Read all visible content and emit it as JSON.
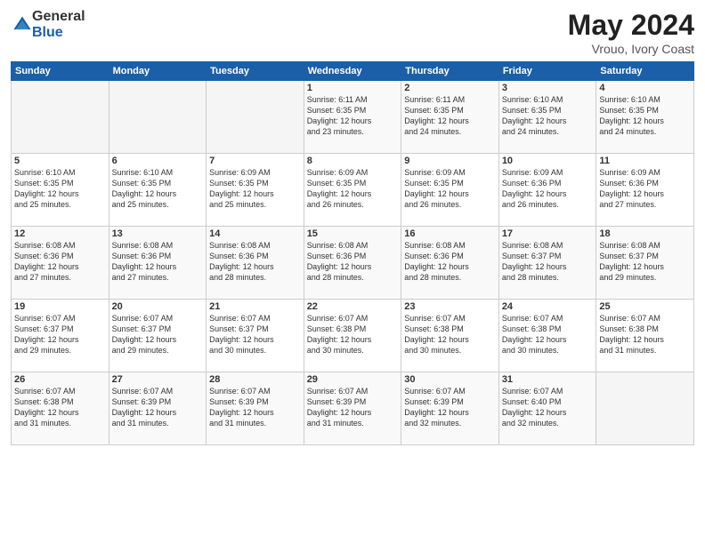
{
  "logo": {
    "general": "General",
    "blue": "Blue"
  },
  "title": {
    "month": "May 2024",
    "location": "Vrouo, Ivory Coast"
  },
  "days_header": [
    "Sunday",
    "Monday",
    "Tuesday",
    "Wednesday",
    "Thursday",
    "Friday",
    "Saturday"
  ],
  "weeks": [
    [
      {
        "num": "",
        "info": ""
      },
      {
        "num": "",
        "info": ""
      },
      {
        "num": "",
        "info": ""
      },
      {
        "num": "1",
        "info": "Sunrise: 6:11 AM\nSunset: 6:35 PM\nDaylight: 12 hours\nand 23 minutes."
      },
      {
        "num": "2",
        "info": "Sunrise: 6:11 AM\nSunset: 6:35 PM\nDaylight: 12 hours\nand 24 minutes."
      },
      {
        "num": "3",
        "info": "Sunrise: 6:10 AM\nSunset: 6:35 PM\nDaylight: 12 hours\nand 24 minutes."
      },
      {
        "num": "4",
        "info": "Sunrise: 6:10 AM\nSunset: 6:35 PM\nDaylight: 12 hours\nand 24 minutes."
      }
    ],
    [
      {
        "num": "5",
        "info": "Sunrise: 6:10 AM\nSunset: 6:35 PM\nDaylight: 12 hours\nand 25 minutes."
      },
      {
        "num": "6",
        "info": "Sunrise: 6:10 AM\nSunset: 6:35 PM\nDaylight: 12 hours\nand 25 minutes."
      },
      {
        "num": "7",
        "info": "Sunrise: 6:09 AM\nSunset: 6:35 PM\nDaylight: 12 hours\nand 25 minutes."
      },
      {
        "num": "8",
        "info": "Sunrise: 6:09 AM\nSunset: 6:35 PM\nDaylight: 12 hours\nand 26 minutes."
      },
      {
        "num": "9",
        "info": "Sunrise: 6:09 AM\nSunset: 6:35 PM\nDaylight: 12 hours\nand 26 minutes."
      },
      {
        "num": "10",
        "info": "Sunrise: 6:09 AM\nSunset: 6:36 PM\nDaylight: 12 hours\nand 26 minutes."
      },
      {
        "num": "11",
        "info": "Sunrise: 6:09 AM\nSunset: 6:36 PM\nDaylight: 12 hours\nand 27 minutes."
      }
    ],
    [
      {
        "num": "12",
        "info": "Sunrise: 6:08 AM\nSunset: 6:36 PM\nDaylight: 12 hours\nand 27 minutes."
      },
      {
        "num": "13",
        "info": "Sunrise: 6:08 AM\nSunset: 6:36 PM\nDaylight: 12 hours\nand 27 minutes."
      },
      {
        "num": "14",
        "info": "Sunrise: 6:08 AM\nSunset: 6:36 PM\nDaylight: 12 hours\nand 28 minutes."
      },
      {
        "num": "15",
        "info": "Sunrise: 6:08 AM\nSunset: 6:36 PM\nDaylight: 12 hours\nand 28 minutes."
      },
      {
        "num": "16",
        "info": "Sunrise: 6:08 AM\nSunset: 6:36 PM\nDaylight: 12 hours\nand 28 minutes."
      },
      {
        "num": "17",
        "info": "Sunrise: 6:08 AM\nSunset: 6:37 PM\nDaylight: 12 hours\nand 28 minutes."
      },
      {
        "num": "18",
        "info": "Sunrise: 6:08 AM\nSunset: 6:37 PM\nDaylight: 12 hours\nand 29 minutes."
      }
    ],
    [
      {
        "num": "19",
        "info": "Sunrise: 6:07 AM\nSunset: 6:37 PM\nDaylight: 12 hours\nand 29 minutes."
      },
      {
        "num": "20",
        "info": "Sunrise: 6:07 AM\nSunset: 6:37 PM\nDaylight: 12 hours\nand 29 minutes."
      },
      {
        "num": "21",
        "info": "Sunrise: 6:07 AM\nSunset: 6:37 PM\nDaylight: 12 hours\nand 30 minutes."
      },
      {
        "num": "22",
        "info": "Sunrise: 6:07 AM\nSunset: 6:38 PM\nDaylight: 12 hours\nand 30 minutes."
      },
      {
        "num": "23",
        "info": "Sunrise: 6:07 AM\nSunset: 6:38 PM\nDaylight: 12 hours\nand 30 minutes."
      },
      {
        "num": "24",
        "info": "Sunrise: 6:07 AM\nSunset: 6:38 PM\nDaylight: 12 hours\nand 30 minutes."
      },
      {
        "num": "25",
        "info": "Sunrise: 6:07 AM\nSunset: 6:38 PM\nDaylight: 12 hours\nand 31 minutes."
      }
    ],
    [
      {
        "num": "26",
        "info": "Sunrise: 6:07 AM\nSunset: 6:38 PM\nDaylight: 12 hours\nand 31 minutes."
      },
      {
        "num": "27",
        "info": "Sunrise: 6:07 AM\nSunset: 6:39 PM\nDaylight: 12 hours\nand 31 minutes."
      },
      {
        "num": "28",
        "info": "Sunrise: 6:07 AM\nSunset: 6:39 PM\nDaylight: 12 hours\nand 31 minutes."
      },
      {
        "num": "29",
        "info": "Sunrise: 6:07 AM\nSunset: 6:39 PM\nDaylight: 12 hours\nand 31 minutes."
      },
      {
        "num": "30",
        "info": "Sunrise: 6:07 AM\nSunset: 6:39 PM\nDaylight: 12 hours\nand 32 minutes."
      },
      {
        "num": "31",
        "info": "Sunrise: 6:07 AM\nSunset: 6:40 PM\nDaylight: 12 hours\nand 32 minutes."
      },
      {
        "num": "",
        "info": ""
      }
    ]
  ]
}
